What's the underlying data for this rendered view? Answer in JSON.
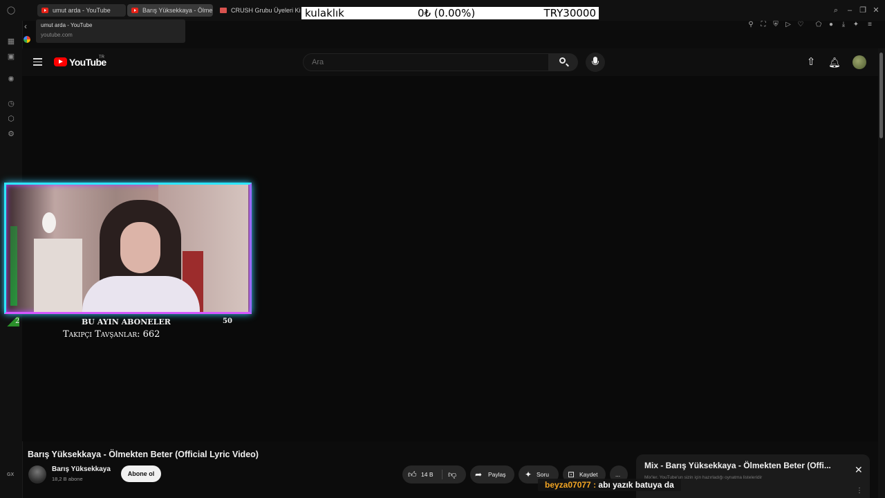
{
  "browser": {
    "tabs": [
      {
        "label": "umut arda - YouTube",
        "active": true
      },
      {
        "label": "Barış Yüksekkaya - Ölmekten",
        "active": false
      },
      {
        "label": "CRUSH Grubu Üyeleri Kim",
        "active": false
      }
    ],
    "tooltip": {
      "title": "umut arda - YouTube",
      "url": "youtube.com"
    },
    "rail_icons": [
      "opera-icon",
      "whatsapp-icon",
      "messenger-icon",
      "settings-icon",
      "history-icon",
      "extensions-icon",
      "gear-icon"
    ]
  },
  "stream_ticker": {
    "product": "kulaklık",
    "balance": "0₺ (0.00%)",
    "goal": "TRY30000"
  },
  "youtube": {
    "logo_text": "YouTube",
    "country_code": "TR",
    "search": {
      "placeholder": "Ara",
      "value": ""
    },
    "video": {
      "title": "Barış Yüksekkaya - Ölmekten Beter (Official Lyric Video)",
      "channel": "Barış Yüksekkaya",
      "subscribers": "18,2 B abone",
      "subscribe_label": "Abone ol",
      "likes": "14 B",
      "share_label": "Paylaş",
      "ask_label": "Soru",
      "save_label": "Kaydet",
      "more_label": "..."
    },
    "mix": {
      "title": "Mix - Barış Yüksekkaya - Ölmekten Beter (Offi...",
      "subtitle": "Mix'ler, YouTube'un sizin için hazırladığı oynatma listeleridir"
    }
  },
  "overlay": {
    "subs_left_count": "2",
    "subs_label": "BU AYIN ABONELER",
    "subs_count": "50",
    "followers_label": "Takipçi Tavşanlar: 662",
    "chat": {
      "user": "beyza07077",
      "separator": ":",
      "message": "abı yazık batuya da"
    }
  },
  "colors": {
    "youtube_red": "#ff0000",
    "chat_name": "#f5a623",
    "webcam_border": "#2ee6ff",
    "webcam_glow": "#d657ff"
  }
}
